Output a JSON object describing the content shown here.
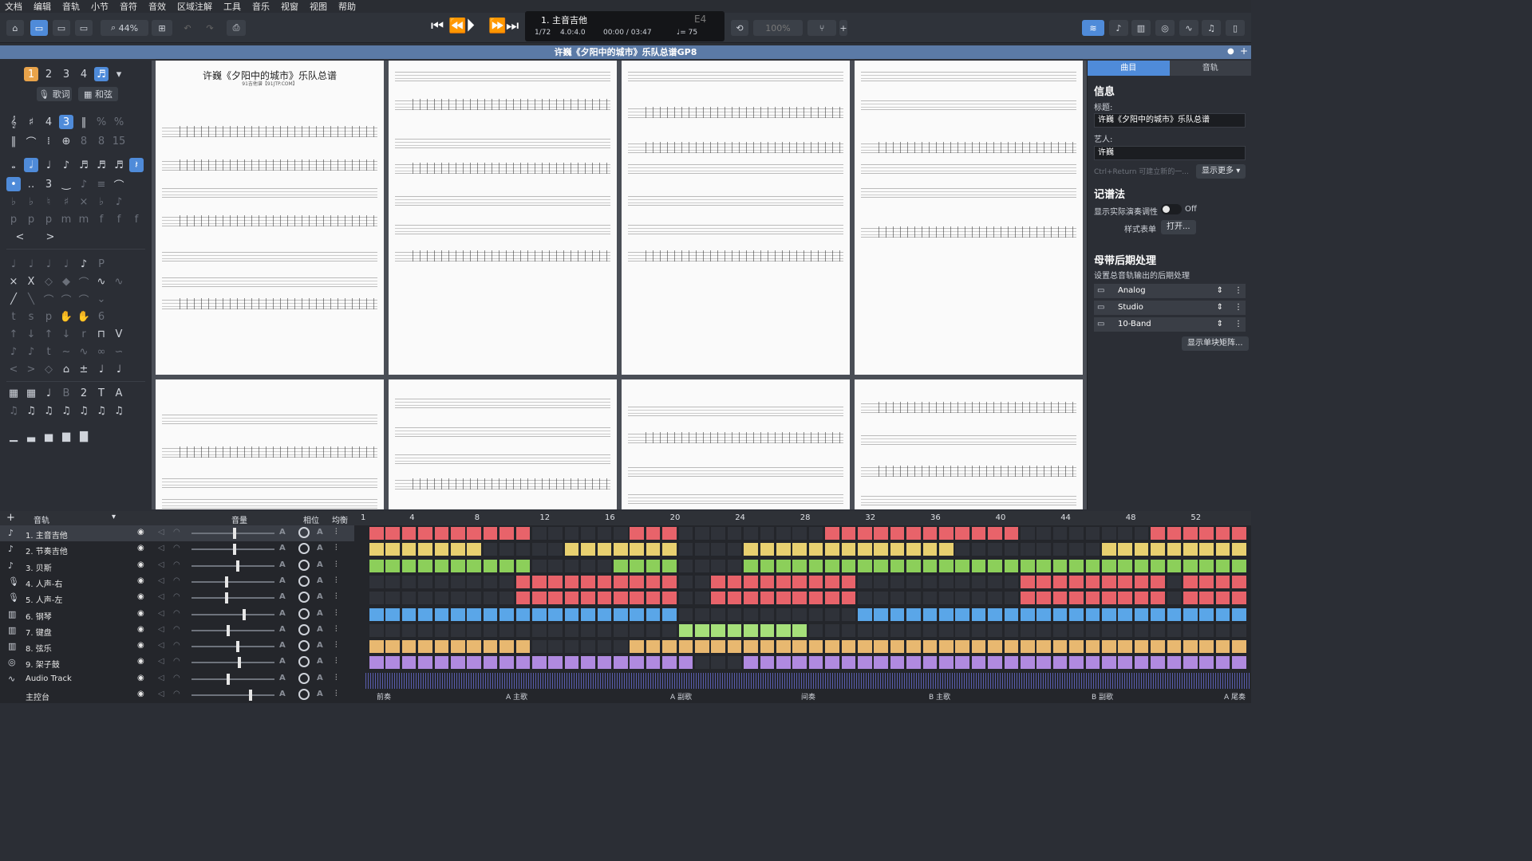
{
  "menu": [
    "文档",
    "编辑",
    "音轨",
    "小节",
    "音符",
    "音效",
    "区域注解",
    "工具",
    "音乐",
    "视窗",
    "视图",
    "帮助"
  ],
  "toolbar": {
    "zoom": "44%",
    "lcd": {
      "track": "1. 主音吉他",
      "bar": "1/72",
      "signature": "4.0:4.0",
      "time": "00:00 / 03:47",
      "tempo": "♩= 75",
      "key": "E4",
      "speed": "100%"
    }
  },
  "doc_title": "许巍《夕阳中的城市》乐队总谱GP8",
  "leftpanel": {
    "number_tabs": [
      "1",
      "2",
      "3",
      "4"
    ],
    "lyric_btn": "歌词",
    "chord_btn": "和弦"
  },
  "score": {
    "page1_title": "许巍《夕阳中的城市》乐队总谱",
    "page1_sub": "91吉他谱【91JTP.COM】"
  },
  "rightpanel": {
    "tabs": [
      "曲目",
      "音轨"
    ],
    "info_h": "信息",
    "title_lbl": "标题:",
    "title_val": "许巍《夕阳中的城市》乐队总谱",
    "artist_lbl": "艺人:",
    "artist_val": "许巍",
    "hint": "Ctrl+Return 可建立新的一...",
    "more_btn": "显示更多",
    "notation_h": "记谱法",
    "concert_lbl": "显示实际演奏调性",
    "toggle_state": "Off",
    "style_lbl": "样式表单",
    "open_btn": "打开...",
    "master_h": "母带后期处理",
    "master_desc": "设置总音轨输出的后期处理",
    "fx": [
      "Analog",
      "Studio",
      "10-Band"
    ],
    "single_btn": "显示单块矩阵..."
  },
  "tracks": {
    "header": {
      "tracks": "音轨",
      "volume": "音量",
      "pan": "相位",
      "eq": "均衡"
    },
    "list": [
      {
        "name": "1. 主音吉他",
        "icon": "guitar-icon",
        "vol": 0.52
      },
      {
        "name": "2. 节奏吉他",
        "icon": "guitar-icon",
        "vol": 0.52
      },
      {
        "name": "3. 贝斯",
        "icon": "bass-icon",
        "vol": 0.56
      },
      {
        "name": "4. 人声-右",
        "icon": "mic-icon",
        "vol": 0.42
      },
      {
        "name": "5. 人声-左",
        "icon": "mic-icon",
        "vol": 0.42
      },
      {
        "name": "6. 钢琴",
        "icon": "piano-icon",
        "vol": 0.64
      },
      {
        "name": "7. 键盘",
        "icon": "piano-icon",
        "vol": 0.44
      },
      {
        "name": "8. 弦乐",
        "icon": "strings-icon",
        "vol": 0.56
      },
      {
        "name": "9. 架子鼓",
        "icon": "drum-icon",
        "vol": 0.58
      },
      {
        "name": "Audio Track",
        "icon": "waveform-icon",
        "vol": 0.44
      },
      {
        "name": "主控台",
        "icon": "",
        "vol": 0.72
      }
    ]
  },
  "timeline": {
    "bar_numbers": [
      "1",
      "4",
      "8",
      "12",
      "16",
      "20",
      "24",
      "28",
      "32",
      "36",
      "40",
      "44",
      "48",
      "52"
    ],
    "colors": [
      "#e8636a",
      "#e8d070",
      "#8ccf5a",
      "#e8636a",
      "#e8636a",
      "#5aa6e8",
      "#a6e07a",
      "#e8b870",
      "#b08ae0"
    ],
    "markers": [
      "前奏",
      "A 主歌",
      "A 副歌",
      "间奏",
      "B 主歌",
      "B 副歌",
      "A 尾奏"
    ]
  }
}
